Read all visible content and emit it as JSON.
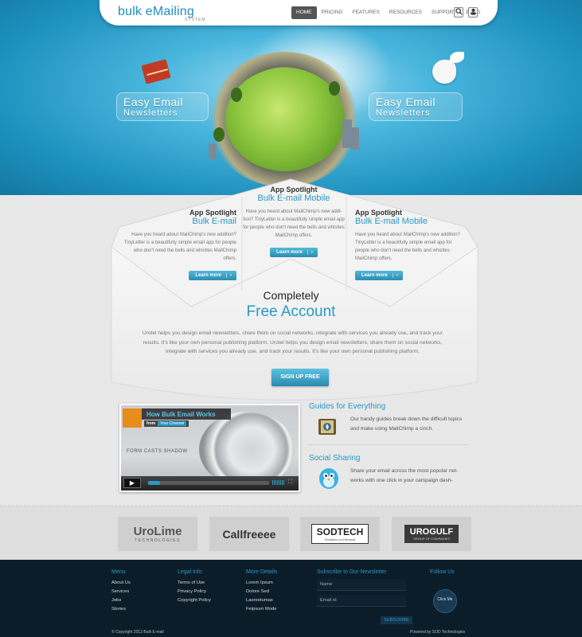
{
  "header": {
    "logo": "bulk eMailing",
    "logo_sub": "SYSTEM",
    "nav": [
      "HOME",
      "PRICING",
      "FEATURES",
      "RESOURCES",
      "SUPPORT",
      "BLOG"
    ],
    "active_nav": "HOME",
    "icons": [
      "search-icon",
      "user-icon"
    ]
  },
  "hero": {
    "left_caption": {
      "line1": "Easy Email",
      "line2": "Newsletters"
    },
    "right_caption": {
      "line1": "Easy Email",
      "line2": "Newsletters"
    }
  },
  "spotlights": [
    {
      "heading": "App Spotlight",
      "title": "Bulk E-mail",
      "desc": "Have you heard about MailChimp's new addition? TinyLetter is a beautifully simple email app for people who don't need the bells and whistles MailChimp offers.",
      "button": "Learn more",
      "arrow": "›"
    },
    {
      "heading": "App Spotlight",
      "title": "Bulk E-mail Mobile",
      "desc": "Have you heard about MailChimp's new addi-tion? TinyLetter is a beautifully simple email app for people who don't need the bells and whistles MailChimp offers.",
      "button": "Learn more",
      "arrow": "›"
    },
    {
      "heading": "App Spotlight",
      "title": "Bulk E-mail Mobile",
      "desc": "Have you heard about MailChimp's new addition? TinyLetter is a beautifully simple email app for people who don't need the bells and whistles MailChimp offers.",
      "button": "Learn more",
      "arrow": "›"
    }
  ],
  "free": {
    "title": "Completely",
    "subtitle": "Free Account",
    "desc": "Urotel helps you design email newsletters, share them on social networks, integrate  with services you already use, and track your results. It's like your own personal publishing platform. Urotel helps you design email newsletters, share them on social networks, integrate  with services you already use, and track your results. It's like your own personal publishing platform.",
    "signup": "SIGN UP FREE"
  },
  "video": {
    "title": "How Bulk Email Works",
    "from_label": "from",
    "channel": "Your Channel",
    "caption": "FORM CASTS SHADOW",
    "progress": 0.1
  },
  "features": [
    {
      "title": "Guides for Everything",
      "desc": "Our handy guides break down the difficult topics and make using MailChimp a cinch.",
      "icon": "guide-book-icon"
    },
    {
      "title": "Social Sharing",
      "desc": "Share your email across the most popular net-works with one click in your campaign dash-",
      "icon": "twitter-bird-icon"
    }
  ],
  "partners": [
    {
      "name": "UroLime",
      "sub": "TECHNOLOGIES"
    },
    {
      "name": "Callfreeee",
      "sub": ""
    },
    {
      "name": "SODTECH",
      "sub": "Solutions on Demand"
    },
    {
      "name": "UROGULF",
      "sub": "GROUP OF COMPANIES"
    }
  ],
  "footer": {
    "menu": {
      "title": "Menu",
      "links": [
        "About Us",
        "Services",
        "Jobs",
        "Stories"
      ]
    },
    "legal": {
      "title": "Legal Info",
      "links": [
        "Terms of Use",
        "Privacy Policy",
        "Copyright Policy"
      ]
    },
    "more": {
      "title": "More Details",
      "links": [
        "Lorem Ipsum",
        "Dolore Sed",
        "Laoreetumas",
        "Feipsum Mode"
      ]
    },
    "newsletter": {
      "title": "Subscribe to Our Newsletter",
      "name_placeholder": "Name",
      "email_placeholder": "Email id",
      "button": "SUBSCRIBE"
    },
    "follow": {
      "title": "Follow Us",
      "click": "Click Me"
    },
    "copyright": "© Copyright 2012 Bulk E-mail",
    "powered": "Powered by SOD Technologies"
  },
  "colors": {
    "accent": "#2a98c3",
    "footer_bg": "#0c1d2a",
    "hero": "#1c8fbd"
  }
}
